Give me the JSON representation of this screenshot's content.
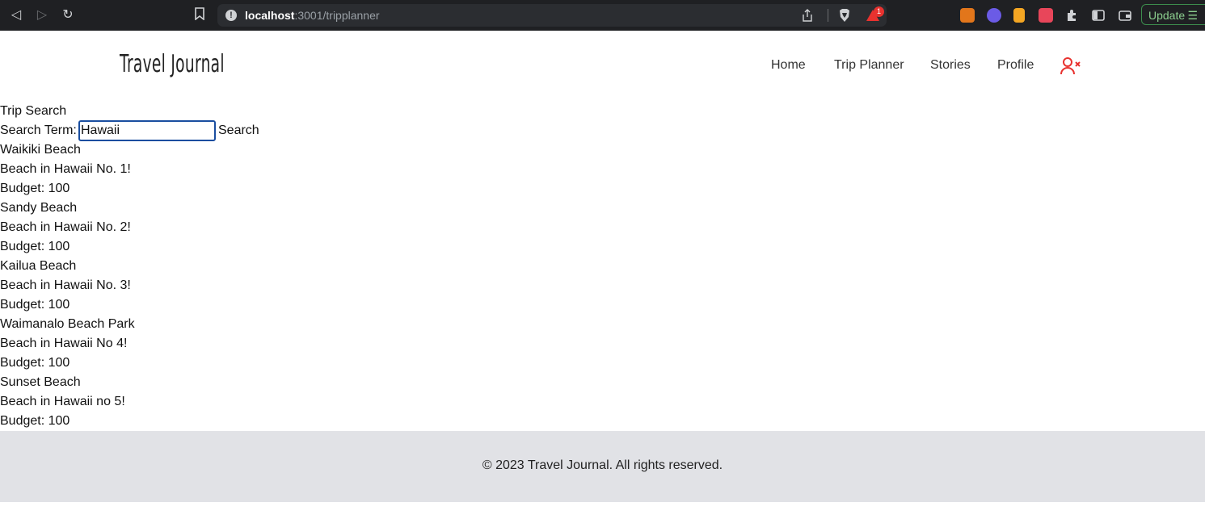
{
  "browser": {
    "url_host": "localhost",
    "url_path": ":3001/tripplanner",
    "notification_count": "1",
    "update_label": "Update"
  },
  "site": {
    "logo": "Travel Journal",
    "nav": [
      {
        "label": "Home"
      },
      {
        "label": "Trip Planner"
      },
      {
        "label": "Stories"
      },
      {
        "label": "Profile"
      }
    ],
    "accent_color": "#e8322f"
  },
  "page": {
    "heading": "Trip Search",
    "search": {
      "label": "Search Term:",
      "value": "Hawaii",
      "button": "Search"
    },
    "results": [
      {
        "name": "Waikiki Beach",
        "description": "Beach in Hawaii No. 1!",
        "budget": "Budget: 100"
      },
      {
        "name": "Sandy Beach",
        "description": "Beach in Hawaii No. 2!",
        "budget": "Budget: 100"
      },
      {
        "name": "Kailua Beach",
        "description": "Beach in Hawaii No. 3!",
        "budget": "Budget: 100"
      },
      {
        "name": "Waimanalo Beach Park",
        "description": "Beach in Hawaii No 4!",
        "budget": "Budget: 100"
      },
      {
        "name": "Sunset Beach",
        "description": "Beach in Hawaii no 5!",
        "budget": "Budget: 100"
      }
    ]
  },
  "footer": {
    "copyright": "© 2023 Travel Journal. All rights reserved."
  }
}
